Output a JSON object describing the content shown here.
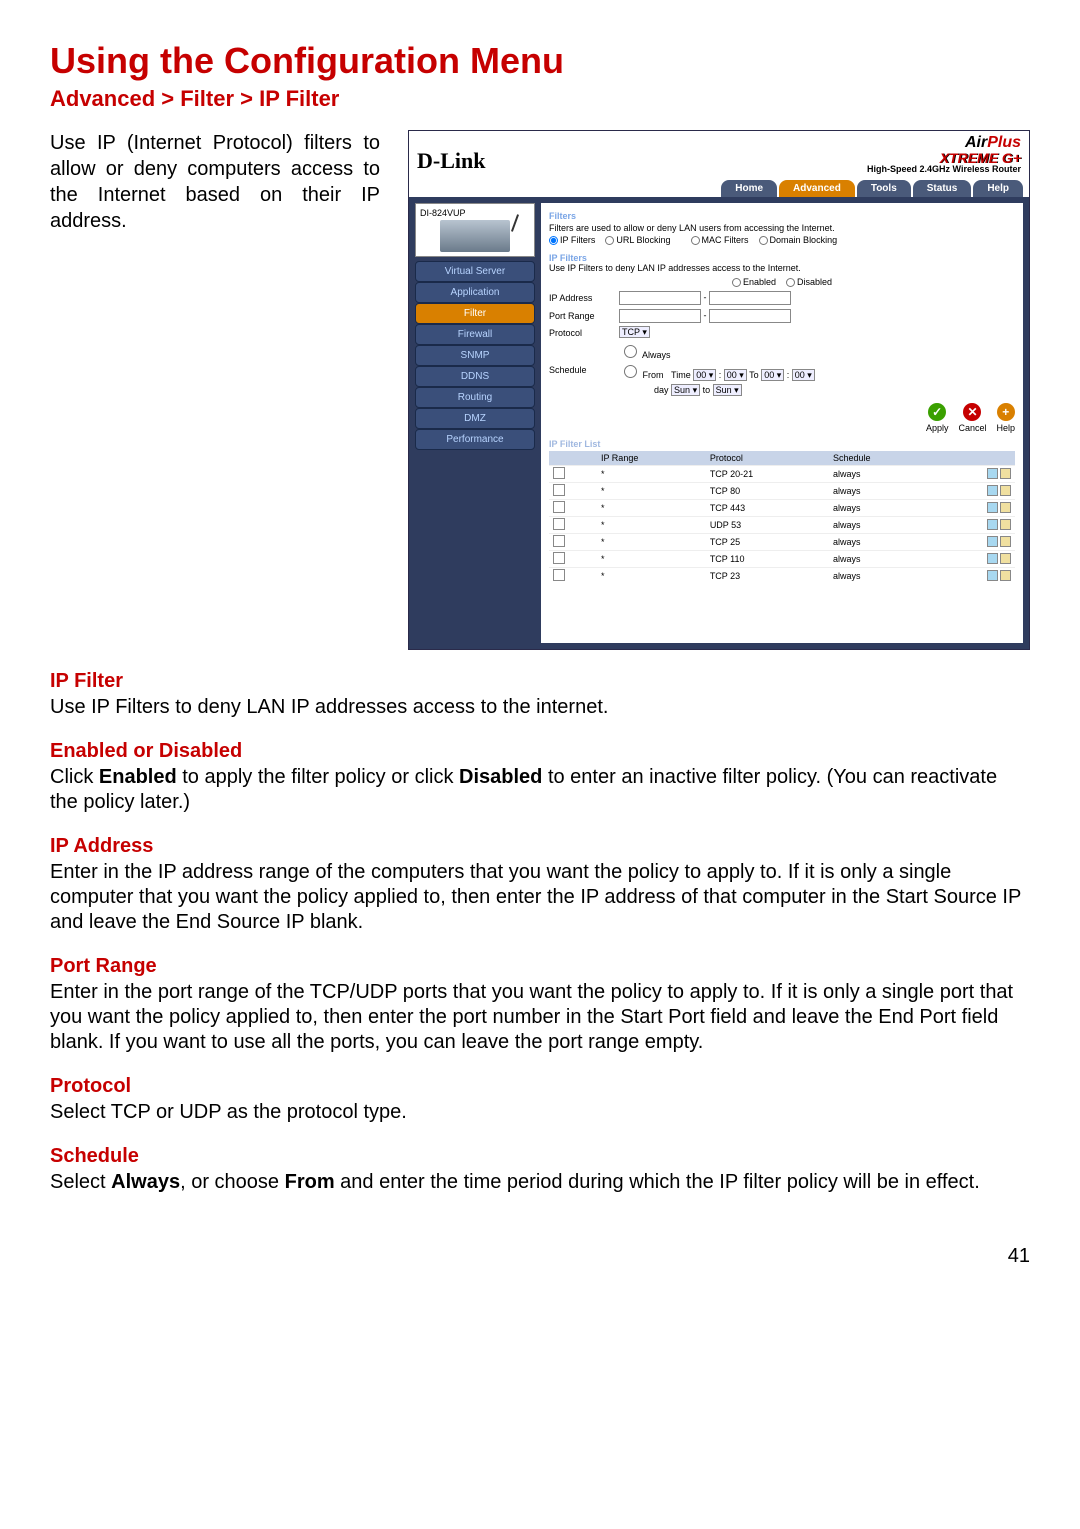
{
  "page_title": "Using the Configuration Menu",
  "breadcrumb": "Advanced > Filter > IP Filter",
  "intro_text": "Use IP (Internet Protocol) filters to allow or deny computers access to the Internet based on their IP address.",
  "screenshot": {
    "brand": "D-Link",
    "product_brand": {
      "air": "Air",
      "plus": "Plus",
      "xtreme": "XTREME G+",
      "sub": "High-Speed 2.4GHz Wireless Router"
    },
    "device_model": "DI-824VUP",
    "tabs": [
      {
        "label": "Home",
        "active": false
      },
      {
        "label": "Advanced",
        "active": true
      },
      {
        "label": "Tools",
        "active": false
      },
      {
        "label": "Status",
        "active": false
      },
      {
        "label": "Help",
        "active": false
      }
    ],
    "sidebar": [
      {
        "label": "Virtual Server",
        "active": false
      },
      {
        "label": "Application",
        "active": false
      },
      {
        "label": "Filter",
        "active": true
      },
      {
        "label": "Firewall",
        "active": false
      },
      {
        "label": "SNMP",
        "active": false
      },
      {
        "label": "DDNS",
        "active": false
      },
      {
        "label": "Routing",
        "active": false
      },
      {
        "label": "DMZ",
        "active": false
      },
      {
        "label": "Performance",
        "active": false
      }
    ],
    "panel": {
      "heading": "Filters",
      "desc": "Filters are used to allow or deny LAN users from accessing the Internet.",
      "filter_types": [
        "IP Filters",
        "URL Blocking",
        "MAC Filters",
        "Domain Blocking"
      ],
      "sub_heading": "IP Filters",
      "sub_desc": "Use IP Filters to deny LAN IP addresses access to the Internet.",
      "enable_opts": [
        "Enabled",
        "Disabled"
      ],
      "rows": {
        "ip_address": "IP Address",
        "port_range": "Port Range",
        "protocol": "Protocol",
        "protocol_val": "TCP",
        "schedule": "Schedule",
        "sched_always": "Always",
        "sched_from": "From",
        "sched_time_label": "Time",
        "sched_time_vals": [
          "00",
          "00",
          "To",
          "00",
          "00"
        ],
        "sched_day_label": "day",
        "sched_day_from": "Sun",
        "sched_day_to_lbl": "to",
        "sched_day_to": "Sun"
      },
      "actions": {
        "apply": "Apply",
        "cancel": "Cancel",
        "help": "Help"
      },
      "list_title": "IP Filter List",
      "list_headers": [
        "",
        "IP Range",
        "Protocol",
        "Schedule",
        ""
      ],
      "list_rows": [
        {
          "range": "*",
          "protocol": "TCP 20-21",
          "schedule": "always"
        },
        {
          "range": "*",
          "protocol": "TCP 80",
          "schedule": "always"
        },
        {
          "range": "*",
          "protocol": "TCP 443",
          "schedule": "always"
        },
        {
          "range": "*",
          "protocol": "UDP 53",
          "schedule": "always"
        },
        {
          "range": "*",
          "protocol": "TCP 25",
          "schedule": "always"
        },
        {
          "range": "*",
          "protocol": "TCP 110",
          "schedule": "always"
        },
        {
          "range": "*",
          "protocol": "TCP 23",
          "schedule": "always"
        }
      ]
    }
  },
  "sections": [
    {
      "title": "IP Filter",
      "body": "Use IP Filters to deny LAN IP addresses access to the internet."
    },
    {
      "title": "Enabled or Disabled",
      "body_html": "Click <b>Enabled</b> to apply the filter policy or click <b>Disabled</b> to enter an inactive filter policy. (You can reactivate the policy later.)"
    },
    {
      "title": "IP Address",
      "body": "Enter in the IP address range of the computers that you want the policy to apply to.  If it is only a single computer that you want the policy applied to, then enter the IP address of that computer in the Start Source IP and leave the End Source IP blank."
    },
    {
      "title": "Port Range",
      "body": "Enter in the port range of the TCP/UDP ports that you want the policy to apply to.  If it is only a single port  that you want the policy applied to, then enter the port number in the Start Port  field and leave the End Port field blank.  If you want to use all the ports, you can leave the port range empty."
    },
    {
      "title": "Protocol",
      "body": "Select TCP or UDP as the protocol type."
    },
    {
      "title": "Schedule",
      "body_html": "Select <b>Always</b>, or choose <b>From</b> and enter the time period during which the IP filter policy will be in effect."
    }
  ],
  "page_number": "41"
}
